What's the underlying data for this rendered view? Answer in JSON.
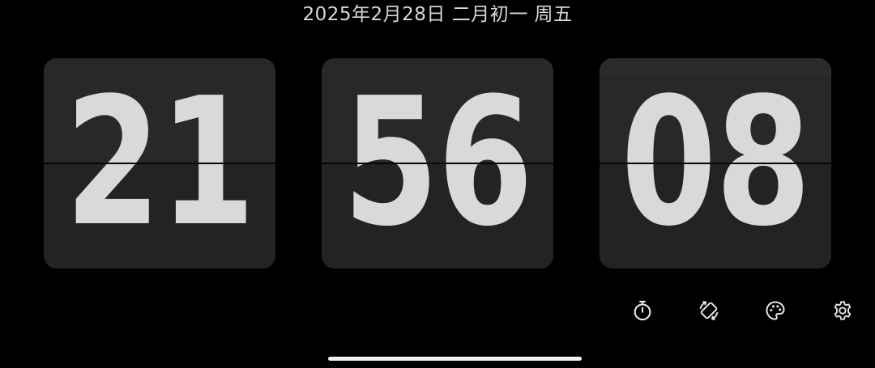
{
  "date_line": "2025年2月28日 二月初一 周五",
  "clock": {
    "hours": "21",
    "minutes": "56",
    "seconds": "08"
  },
  "toolbar": {
    "icons": [
      "stopwatch-icon",
      "screen-rotation-icon",
      "palette-icon",
      "settings-gear-icon"
    ]
  },
  "colors": {
    "background": "#000000",
    "card": "#262626",
    "digit": "#d9d9d9",
    "icon": "#e6e6e6"
  }
}
